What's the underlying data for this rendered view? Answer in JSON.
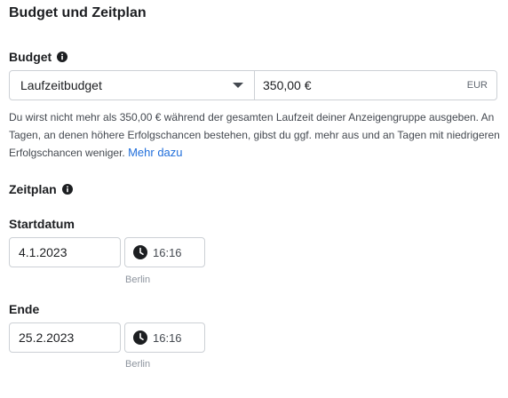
{
  "section_title": "Budget und Zeitplan",
  "budget": {
    "label": "Budget",
    "type_value": "Laufzeitbudget",
    "amount_value": "350,00 €",
    "currency": "EUR",
    "description": "Du wirst nicht mehr als 350,00 € während der gesamten Laufzeit deiner Anzeigengruppe ausgeben. An Tagen, an denen höhere Erfolgschancen bestehen, gibst du ggf. mehr aus und an Tagen mit niedrigeren Erfolgschancen weniger.",
    "learn_more": "Mehr dazu"
  },
  "schedule": {
    "label": "Zeitplan",
    "start": {
      "label": "Startdatum",
      "date": "4.1.2023",
      "time": "16:16",
      "timezone": "Berlin"
    },
    "end": {
      "label": "Ende",
      "date": "25.2.2023",
      "time": "16:16",
      "timezone": "Berlin"
    }
  },
  "icons": {
    "info": "info-icon",
    "dropdown": "caret-down-icon",
    "time": "clock-icon"
  },
  "colors": {
    "link": "#216fdb",
    "border": "#ccd0d5",
    "text": "#1c1e21"
  }
}
